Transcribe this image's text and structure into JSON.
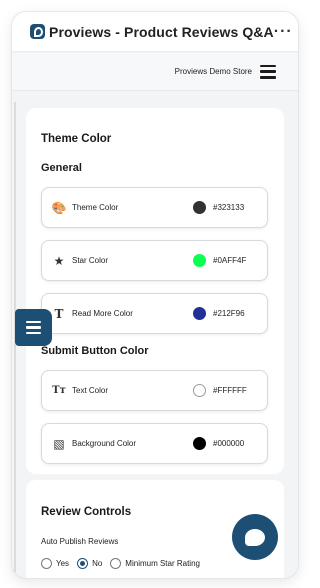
{
  "topbar": {
    "title": "Proviews - Product Reviews Q&A",
    "more_glyph": "···",
    "logo_icon": "proviews-logo-icon"
  },
  "storebar": {
    "store_name": "Proviews Demo Store",
    "menu_icon": "hamburger-icon"
  },
  "theme_card": {
    "title": "Theme Color",
    "general_heading": "General",
    "general_rows": [
      {
        "label": "Theme Color",
        "icon": "palette-icon",
        "glyph": "🎨",
        "color": "#323133",
        "hex": "#323133"
      },
      {
        "label": "Star Color",
        "icon": "star-icon",
        "glyph": "★",
        "color": "#0AFF4F",
        "hex": "#0AFF4F"
      },
      {
        "label": "Read More Color",
        "icon": "text-t-icon",
        "glyph": "T",
        "color": "#212F96",
        "hex": "#212F96"
      }
    ],
    "submit_heading": "Submit Button Color",
    "submit_rows": [
      {
        "label": "Text Color",
        "icon": "text-size-icon",
        "glyph": "Tᴛ",
        "color": "#FFFFFF",
        "hex": "#FFFFFF"
      },
      {
        "label": "Background Color",
        "icon": "image-icon",
        "glyph": "▧",
        "color": "#000000",
        "hex": "#000000"
      }
    ]
  },
  "review_card": {
    "title": "Review Controls",
    "auto_publish_label": "Auto Publish Reviews",
    "options": [
      {
        "label": "Yes",
        "checked": false
      },
      {
        "label": "No",
        "checked": true
      },
      {
        "label": "Minimum Star Rating",
        "checked": false
      }
    ]
  },
  "floating_menu": {
    "icon": "menu-icon"
  },
  "chat": {
    "icon": "chat-bubble-icon"
  },
  "colors": {
    "accent": "#1d4f74",
    "background": "#f2f4f6"
  }
}
